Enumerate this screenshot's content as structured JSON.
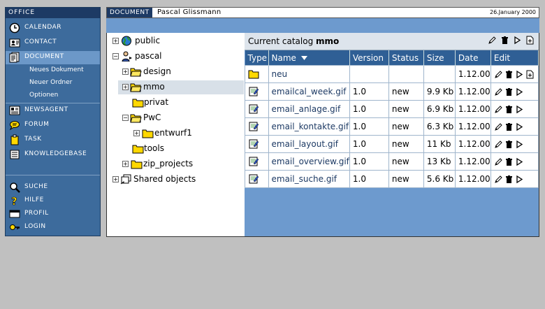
{
  "nav": {
    "header": "OFFICE",
    "items_top": [
      {
        "label": "CALENDAR",
        "icon": "clock-icon"
      },
      {
        "label": "CONTACT",
        "icon": "contact-icon"
      },
      {
        "label": "DOCUMENT",
        "icon": "document-icon",
        "active": true
      }
    ],
    "sub_items": [
      "Neues Dokument",
      "Neuer Ordner",
      "Optionen"
    ],
    "items_mid": [
      {
        "label": "NEWSAGENT",
        "icon": "news-icon"
      },
      {
        "label": "FORUM",
        "icon": "forum-icon"
      },
      {
        "label": "TASK",
        "icon": "task-icon"
      },
      {
        "label": "KNOWLEDGEBASE",
        "icon": "knowledgebase-icon"
      }
    ],
    "items_bottom": [
      {
        "label": "SUCHE",
        "icon": "search-icon"
      },
      {
        "label": "HILFE",
        "icon": "help-icon"
      },
      {
        "label": "PROFIL",
        "icon": "profile-icon"
      },
      {
        "label": "LOGIN",
        "icon": "key-icon"
      }
    ]
  },
  "header": {
    "section": "DOCUMENT",
    "user": "Pascal Glissmann",
    "date": "26.January 2000"
  },
  "tree": {
    "public": "public",
    "pascal": "pascal",
    "design": "design",
    "mmo": "mmo",
    "privat": "privat",
    "pwc": "PwC",
    "entwurf1": "entwurf1",
    "tools": "tools",
    "zip_projects": "zip_projects",
    "shared": "Shared objects"
  },
  "catalog": {
    "prefix": "Current catalog",
    "name": "mmo"
  },
  "table": {
    "headers": {
      "type": "Type",
      "name": "Name",
      "version": "Version",
      "status": "Status",
      "size": "Size",
      "date": "Date",
      "edit": "Edit"
    },
    "rows": [
      {
        "kind": "folder",
        "name": "neu",
        "version": "",
        "status": "",
        "size": "",
        "date": "1.12.00"
      },
      {
        "kind": "file",
        "name": "emailcal_week.gif",
        "version": "1.0",
        "status": "new",
        "size": "9.9 Kb",
        "date": "1.12.00"
      },
      {
        "kind": "file",
        "name": "email_anlage.gif",
        "version": "1.0",
        "status": "new",
        "size": "6.9 Kb",
        "date": "1.12.00"
      },
      {
        "kind": "file",
        "name": "email_kontakte.gif",
        "version": "1.0",
        "status": "new",
        "size": "6.3 Kb",
        "date": "1.12.00"
      },
      {
        "kind": "file",
        "name": "email_layout.gif",
        "version": "1.0",
        "status": "new",
        "size": "11 Kb",
        "date": "1.12.00"
      },
      {
        "kind": "file",
        "name": "email_overview.gif",
        "version": "1.0",
        "status": "new",
        "size": "13 Kb",
        "date": "1.12.00"
      },
      {
        "kind": "file",
        "name": "email_suche.gif",
        "version": "1.0",
        "status": "new",
        "size": "5.6 Kb",
        "date": "1.12.00"
      }
    ]
  },
  "colors": {
    "nav_bg": "#3d6b9c",
    "nav_header": "#1d3a64",
    "table_header": "#2f5f95",
    "panel_bg": "#6d9ace"
  }
}
